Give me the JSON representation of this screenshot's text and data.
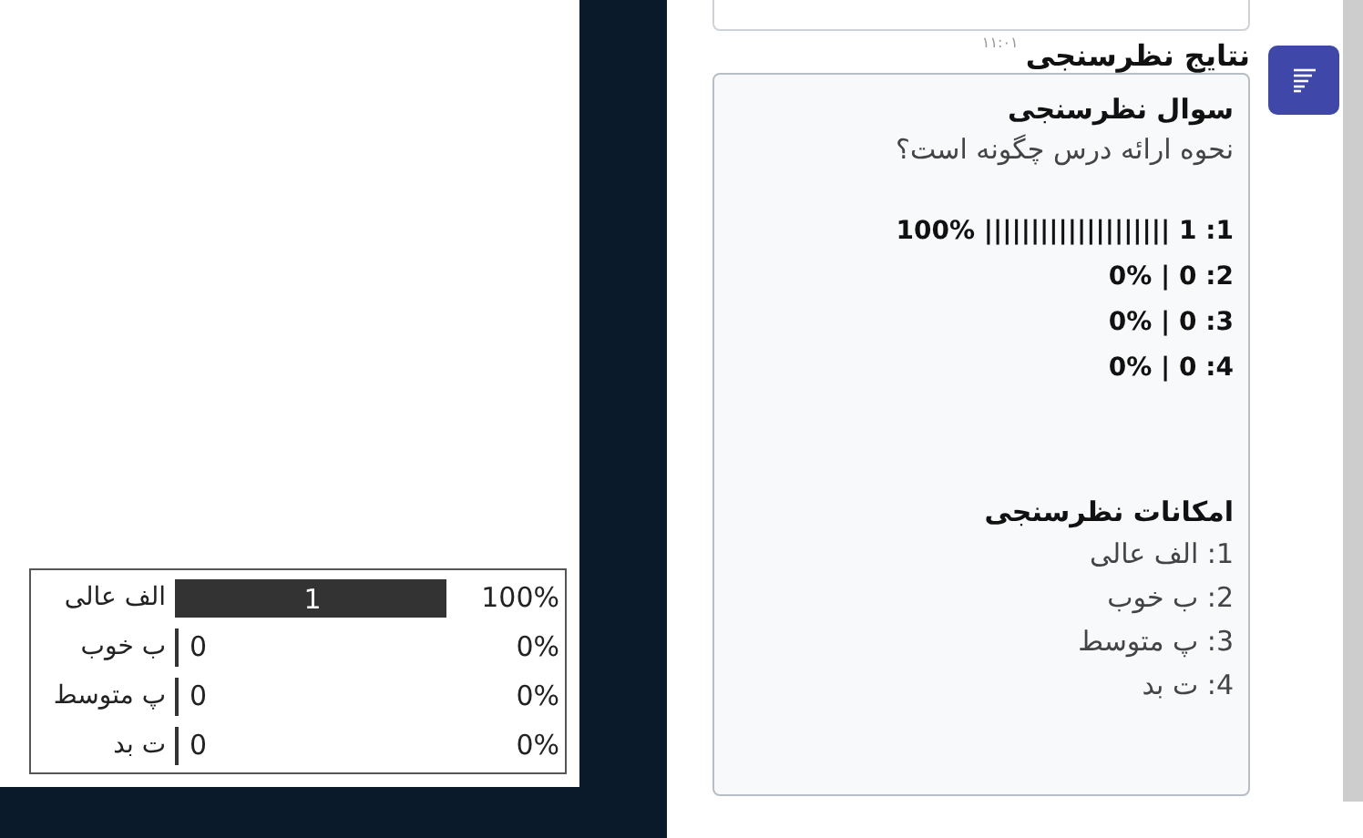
{
  "poll_table": {
    "rows": [
      {
        "label": "الف عالی",
        "count": "1",
        "percent": "100%",
        "level": 1
      },
      {
        "label": "ب خوب",
        "count": "0",
        "percent": "0%",
        "level": 0
      },
      {
        "label": "پ متوسط",
        "count": "0",
        "percent": "0%",
        "level": 0
      },
      {
        "label": "ت بد",
        "count": "0",
        "percent": "0%",
        "level": 0
      }
    ]
  },
  "message": {
    "time": "۱۱:۰۱",
    "title": "نتایج نظرسنجی",
    "question_heading": "سوال نظرسنجی",
    "question": "نحوه ارائه درس چگونه است؟",
    "results": [
      "1: 1 |||||||||||||||||||| 100%",
      "2: 0 | 0%",
      "3: 0 | 0%",
      "4: 0 | 0%"
    ],
    "options_heading": "امکانات نظرسنجی",
    "options": [
      "1: الف عالی",
      "2: ب خوب",
      "3: پ متوسط",
      "4: ت بد"
    ]
  }
}
